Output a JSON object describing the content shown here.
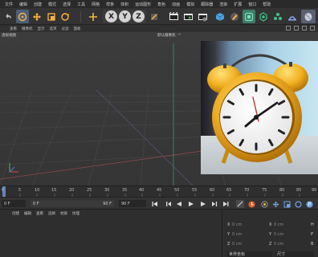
{
  "menubar": {
    "items": [
      "文件",
      "编辑",
      "创建",
      "模式",
      "选择",
      "工具",
      "网格",
      "样条",
      "体积",
      "运动图形",
      "角色",
      "动画",
      "模拟",
      "跟踪器",
      "渲染",
      "扩展",
      "窗口",
      "帮助"
    ]
  },
  "viewport_menu": {
    "items": [
      "查看",
      "摄像机",
      "显示",
      "选项",
      "过滤",
      "面板"
    ]
  },
  "viewport": {
    "view_name": "透视视图",
    "camera_name": "默认摄像机 ◦*"
  },
  "timeline": {
    "ticks": [
      "0",
      "5",
      "10",
      "15",
      "20",
      "25",
      "30",
      "35",
      "40",
      "45",
      "50",
      "55",
      "60",
      "65",
      "70",
      "75",
      "80",
      "85",
      "90"
    ]
  },
  "transport": {
    "current_frame": "0 F",
    "start_frame": "0 F",
    "end_frame": "90 F",
    "preview_end": "90 F"
  },
  "object_manager": {
    "menu": [
      "创建",
      "编辑",
      "查看",
      "选择",
      "材质",
      "纹理"
    ]
  },
  "coordinates": {
    "rows": [
      {
        "axis": "X",
        "pos": "0 cm",
        "axis2": "X",
        "pos2": "0 cm",
        "axis3": "H",
        "rot": "0 °"
      },
      {
        "axis": "Y",
        "pos": "0 cm",
        "axis2": "Y",
        "pos2": "0 cm",
        "axis3": "P",
        "rot": "0 °"
      },
      {
        "axis": "Z",
        "pos": "0 cm",
        "axis2": "Z",
        "pos2": "0 cm",
        "axis3": "B",
        "rot": "0 °"
      }
    ],
    "world_label": "世界坐标",
    "scale_label": "尺寸"
  },
  "colors": {
    "accent": "#6e8fd6",
    "clock_case": "#e8a91c",
    "clock_hand_red": "#c0303a"
  }
}
